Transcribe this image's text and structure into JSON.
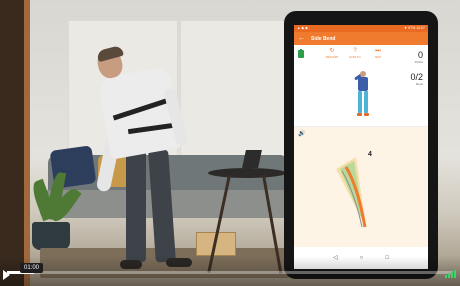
{
  "player": {
    "time": "01:00",
    "progress": 0.06
  },
  "tablet": {
    "status_left": "▲ ◆ ◆",
    "status_right": "▼ 97% 12:07",
    "app_title": "Side Bend",
    "controls": [
      {
        "label": "RESTART",
        "icon": "restart-icon"
      },
      {
        "label": "HOW TO",
        "icon": "help-icon"
      },
      {
        "label": "SKIP",
        "icon": "skip-icon"
      }
    ],
    "points_value": "0",
    "points_label": "Points",
    "reps_value": "0/2",
    "reps_label": "Reps",
    "gauge_value": "4",
    "accent_color": "#f07a2e"
  },
  "icons": [
    "play-icon",
    "volume-icon",
    "back-arrow-icon",
    "battery-icon",
    "speaker-icon",
    "nav-back-icon",
    "nav-home-icon",
    "nav-recents-icon"
  ]
}
